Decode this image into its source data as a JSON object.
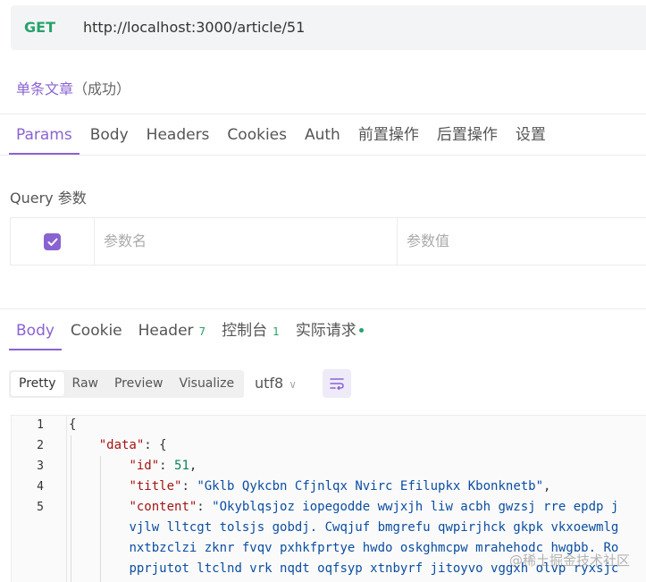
{
  "request": {
    "method": "GET",
    "url": "http://localhost:3000/article/51",
    "name": "单条文章",
    "status": "（成功）"
  },
  "request_tabs": [
    "Params",
    "Body",
    "Headers",
    "Cookies",
    "Auth",
    "前置操作",
    "后置操作",
    "设置"
  ],
  "query": {
    "label": "Query 参数",
    "key_placeholder": "参数名",
    "value_placeholder": "参数值",
    "checked": true
  },
  "response_tabs": {
    "body": "Body",
    "cookie": "Cookie",
    "header": "Header",
    "header_count": "7",
    "console": "控制台",
    "console_count": "1",
    "actual": "实际请求"
  },
  "view_modes": [
    "Pretty",
    "Raw",
    "Preview",
    "Visualize"
  ],
  "encoding": "utf8",
  "code": {
    "line_numbers": [
      "1",
      "2",
      "3",
      "4",
      "5"
    ],
    "brace_open": "{",
    "data_key": "\"data\"",
    "id_key": "\"id\"",
    "id_value": "51",
    "title_key": "\"title\"",
    "title_value": "\"Gklb Qykcbn Cfjnlqx Nvirc Efilupkx Kbonknetb\"",
    "content_key": "\"content\"",
    "content_value_1": "\"Okyblqsjoz iopegodde wwjxjh liw acbh gwzsj rre epdp j",
    "content_value_2": "vjlw lltcgt tolsjs gobdj. Cwqjuf bmgrefu qwpirjhck gkpk vkxoewmlg",
    "content_value_3": "nxtbzclzi zknr fvqv pxhkfprtye hwdo oskghmcpw mrahehodc hwgbb. Ro",
    "content_value_4": "pprjutot ltclnd vrk nqdt oqfsyp xtnbyrf jitoyvo vggxh olvp ryxsjc"
  },
  "watermark": "@稀土掘金技术社区",
  "colors": {
    "accent": "#8a63d2",
    "method_get": "#27a36a",
    "json_key": "#a31515",
    "json_string": "#0b4ea2",
    "json_number": "#098658"
  }
}
